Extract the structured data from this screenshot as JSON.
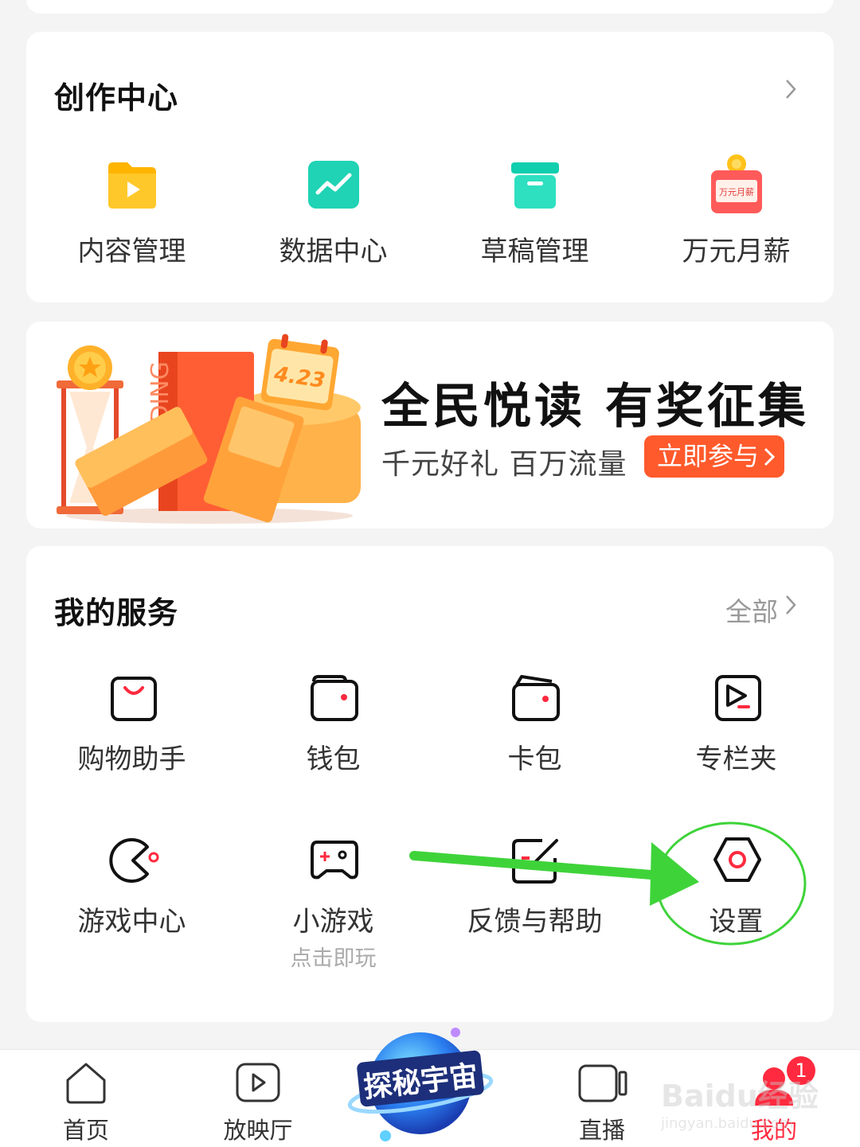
{
  "creation": {
    "title": "创作中心",
    "items": [
      {
        "label": "内容管理",
        "icon": "play-folder-icon"
      },
      {
        "label": "数据中心",
        "icon": "chart-icon"
      },
      {
        "label": "草稿管理",
        "icon": "archive-box-icon"
      },
      {
        "label": "万元月薪",
        "icon": "calendar-salary-icon",
        "icon_text": "万元月薪"
      }
    ]
  },
  "banner": {
    "title": "全民悦读 有奖征集",
    "subtitle": "千元好礼 百万流量",
    "button": "立即参与",
    "art_text_date": "4.23",
    "art_text_book": "READING"
  },
  "services": {
    "title": "我的服务",
    "more": "全部",
    "items": [
      {
        "label": "购物助手",
        "icon": "shopping-bag-icon"
      },
      {
        "label": "钱包",
        "icon": "wallet-icon"
      },
      {
        "label": "卡包",
        "icon": "card-wallet-icon"
      },
      {
        "label": "专栏夹",
        "icon": "column-folder-icon"
      },
      {
        "label": "游戏中心",
        "icon": "game-center-icon"
      },
      {
        "label": "小游戏",
        "sub": "点击即玩",
        "icon": "gamepad-icon"
      },
      {
        "label": "反馈与帮助",
        "icon": "feedback-icon"
      },
      {
        "label": "设置",
        "icon": "settings-hex-icon"
      }
    ]
  },
  "tabbar": {
    "tabs": [
      {
        "label": "首页",
        "icon": "home-icon"
      },
      {
        "label": "放映厅",
        "icon": "video-icon"
      },
      {
        "label": "探秘宇宙",
        "icon": "planet-icon"
      },
      {
        "label": "直播",
        "icon": "camera-icon"
      },
      {
        "label": "我的",
        "icon": "profile-icon",
        "badge": "1",
        "active": true
      }
    ]
  },
  "watermark": {
    "text": "Baidu经验",
    "url_text": "jingyan.baidu.com"
  },
  "colors": {
    "accent_red": "#ff2a3f",
    "annotation_green": "#3fd33a",
    "banner_button": "#ff5a2c"
  }
}
